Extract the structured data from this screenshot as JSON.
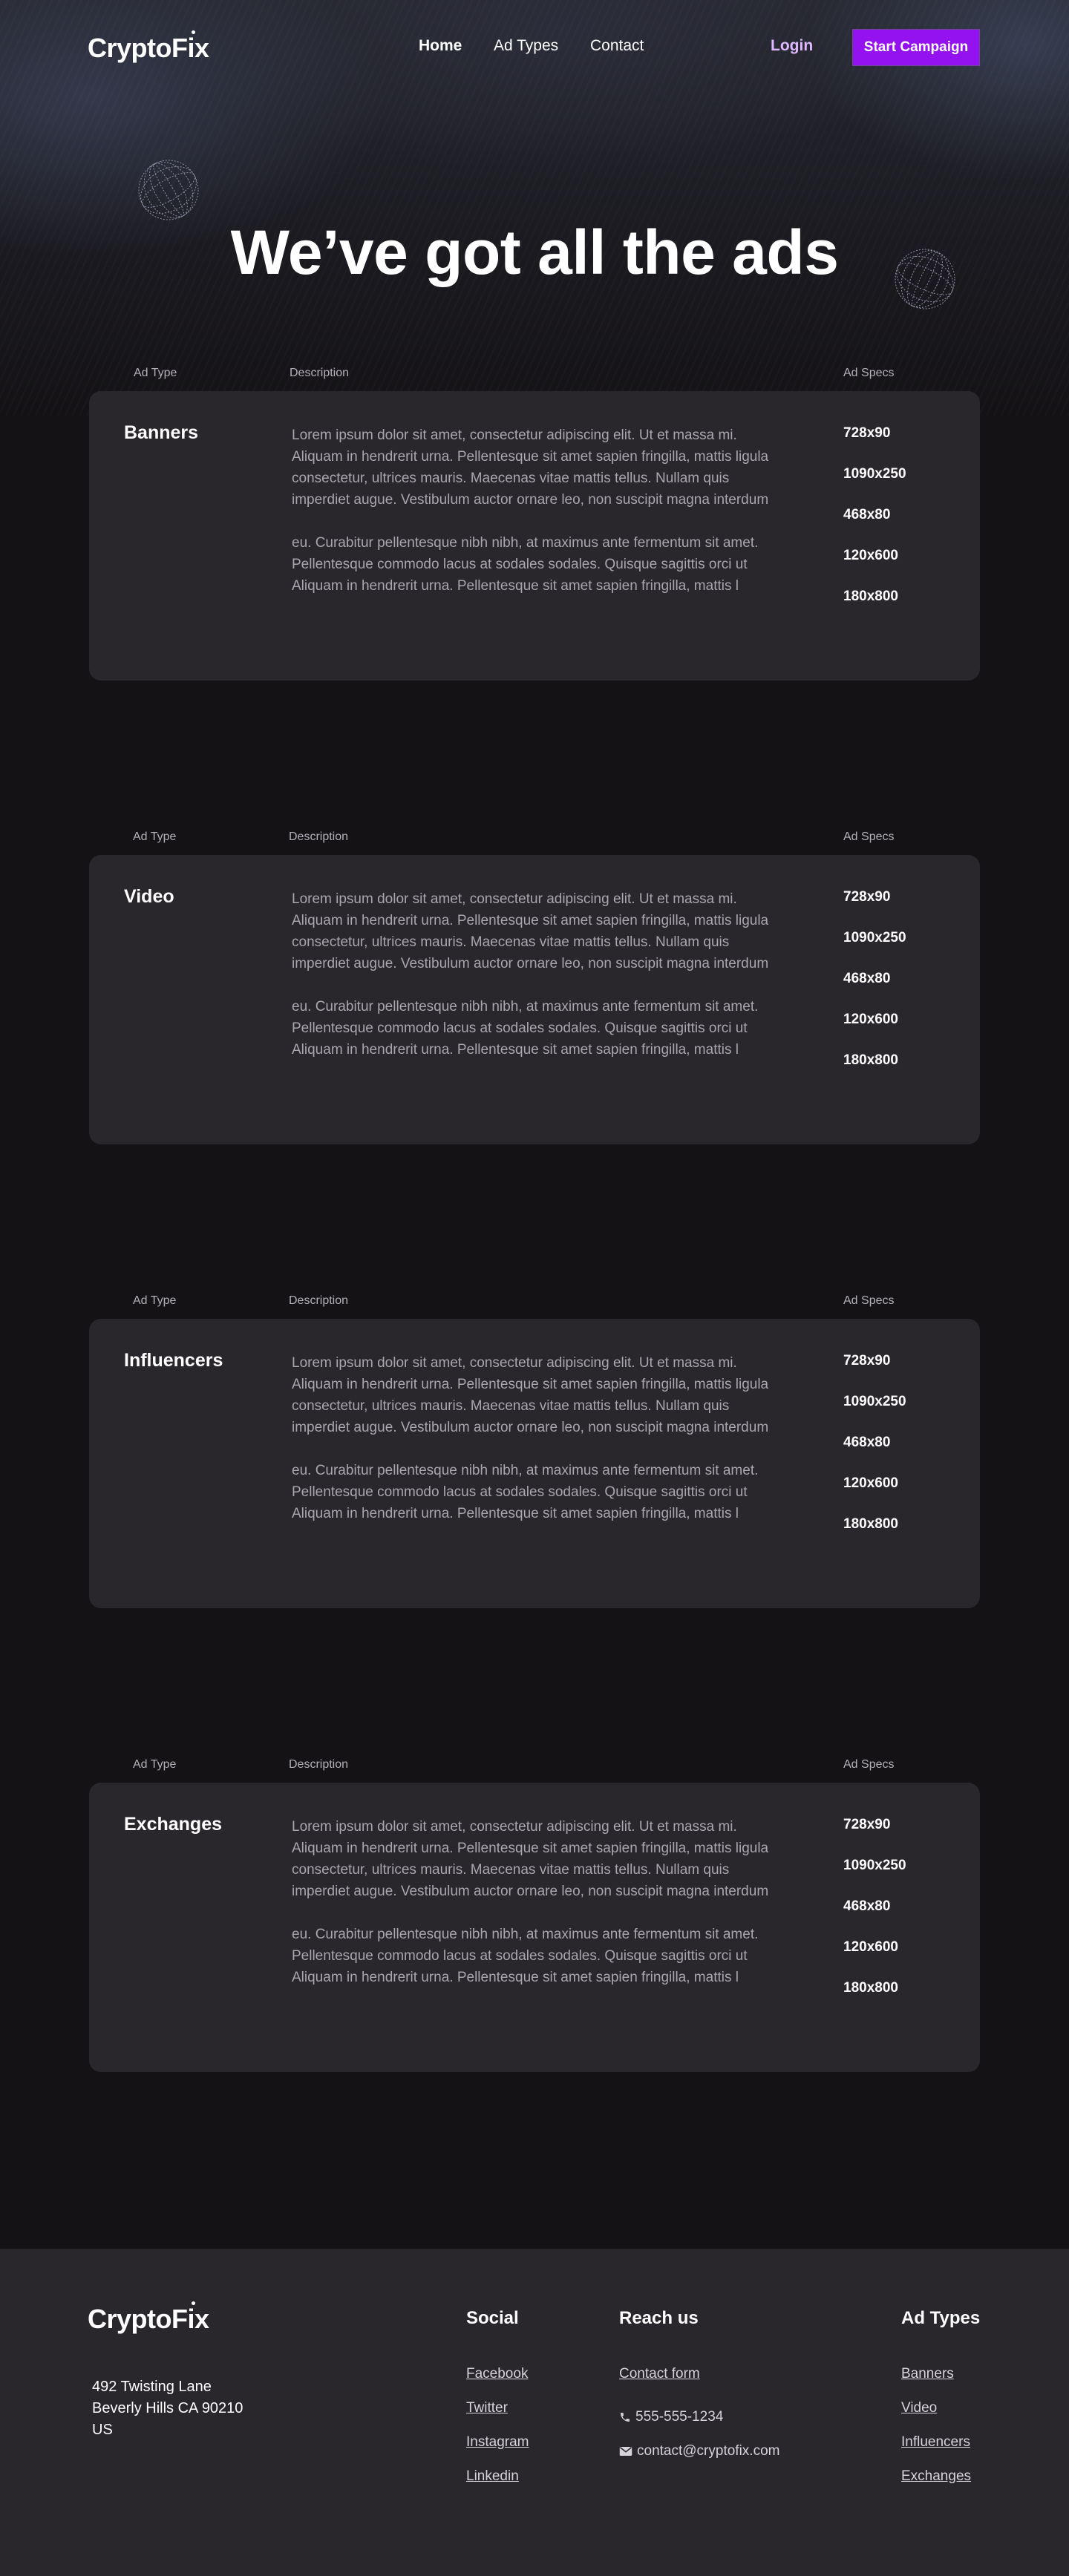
{
  "brand": {
    "name": "CryptoFix"
  },
  "nav": {
    "items": [
      {
        "label": "Home",
        "active": true
      },
      {
        "label": "Ad Types",
        "active": false
      },
      {
        "label": "Contact",
        "active": false
      }
    ],
    "login_label": "Login",
    "cta_label": "Start Campaign"
  },
  "hero": {
    "title": "We’ve got all the ads"
  },
  "columns": {
    "ad_type": "Ad Type",
    "description": "Description",
    "ad_specs": "Ad Specs"
  },
  "ad_sections": [
    {
      "type": "Banners",
      "description": [
        "Lorem ipsum dolor sit amet, consectetur adipiscing elit. Ut et massa mi. Aliquam in hendrerit urna. Pellentesque sit amet sapien fringilla, mattis ligula consectetur, ultrices mauris. Maecenas vitae mattis tellus. Nullam quis imperdiet augue. Vestibulum auctor ornare leo, non suscipit magna interdum",
        "eu. Curabitur pellentesque nibh nibh, at maximus ante fermentum sit amet. Pellentesque commodo lacus at sodales sodales. Quisque sagittis orci ut\nAliquam in hendrerit urna. Pellentesque sit amet sapien fringilla, mattis l"
      ],
      "specs": [
        "728x90",
        "1090x250",
        "468x80",
        "120x600",
        "180x800"
      ]
    },
    {
      "type": "Video",
      "description": [
        "Lorem ipsum dolor sit amet, consectetur adipiscing elit. Ut et massa mi. Aliquam in hendrerit urna. Pellentesque sit amet sapien fringilla, mattis ligula consectetur, ultrices mauris. Maecenas vitae mattis tellus. Nullam quis imperdiet augue. Vestibulum auctor ornare leo, non suscipit magna interdum",
        "eu. Curabitur pellentesque nibh nibh, at maximus ante fermentum sit amet. Pellentesque commodo lacus at sodales sodales. Quisque sagittis orci ut\nAliquam in hendrerit urna. Pellentesque sit amet sapien fringilla, mattis l"
      ],
      "specs": [
        "728x90",
        "1090x250",
        "468x80",
        "120x600",
        "180x800"
      ]
    },
    {
      "type": "Influencers",
      "description": [
        "Lorem ipsum dolor sit amet, consectetur adipiscing elit. Ut et massa mi. Aliquam in hendrerit urna. Pellentesque sit amet sapien fringilla, mattis ligula consectetur, ultrices mauris. Maecenas vitae mattis tellus. Nullam quis imperdiet augue. Vestibulum auctor ornare leo, non suscipit magna interdum",
        "eu. Curabitur pellentesque nibh nibh, at maximus ante fermentum sit amet. Pellentesque commodo lacus at sodales sodales. Quisque sagittis orci ut\nAliquam in hendrerit urna. Pellentesque sit amet sapien fringilla, mattis l"
      ],
      "specs": [
        "728x90",
        "1090x250",
        "468x80",
        "120x600",
        "180x800"
      ]
    },
    {
      "type": "Exchanges",
      "description": [
        "Lorem ipsum dolor sit amet, consectetur adipiscing elit. Ut et massa mi. Aliquam in hendrerit urna. Pellentesque sit amet sapien fringilla, mattis ligula consectetur, ultrices mauris. Maecenas vitae mattis tellus. Nullam quis imperdiet augue. Vestibulum auctor ornare leo, non suscipit magna interdum",
        "eu. Curabitur pellentesque nibh nibh, at maximus ante fermentum sit amet. Pellentesque commodo lacus at sodales sodales. Quisque sagittis orci ut\nAliquam in hendrerit urna. Pellentesque sit amet sapien fringilla, mattis l"
      ],
      "specs": [
        "728x90",
        "1090x250",
        "468x80",
        "120x600",
        "180x800"
      ]
    }
  ],
  "footer": {
    "brand": "CryptoFix",
    "address": [
      "492 Twisting Lane",
      "Beverly Hills CA 90210",
      "US"
    ],
    "social": {
      "title": "Social",
      "links": [
        "Facebook",
        "Twitter",
        "Instagram",
        "Linkedin"
      ]
    },
    "reach": {
      "title": "Reach us",
      "contact_form": "Contact form",
      "phone": "555-555-1234",
      "phone_icon": "phone-icon",
      "email": "contact@cryptofix.com",
      "email_icon": "mail-icon"
    },
    "ad_types": {
      "title": "Ad Types",
      "links": [
        "Banners",
        "Video",
        "Influencers",
        "Exchanges"
      ]
    }
  },
  "colors": {
    "background": "#141215",
    "card": "#29262c",
    "accent": "#9512f0",
    "login": "#e0b8ff",
    "muted_text": "#a9a6ae"
  }
}
